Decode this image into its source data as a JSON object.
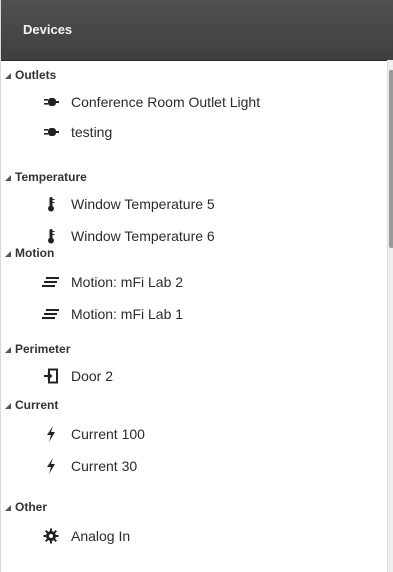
{
  "header": {
    "title": "Devices"
  },
  "groups": [
    {
      "label": "Outlets",
      "items": [
        {
          "label": "Conference Room Outlet Light",
          "icon": "plug-icon"
        },
        {
          "label": "testing",
          "icon": "plug-icon"
        }
      ]
    },
    {
      "label": "Temperature",
      "items": [
        {
          "label": "Window Temperature 5",
          "icon": "thermometer-icon"
        },
        {
          "label": "Window Temperature 6",
          "icon": "thermometer-icon"
        }
      ]
    },
    {
      "label": "Motion",
      "items": [
        {
          "label": "Motion: mFi Lab 2",
          "icon": "motion-icon"
        },
        {
          "label": "Motion: mFi Lab 1",
          "icon": "motion-icon"
        }
      ]
    },
    {
      "label": "Perimeter",
      "items": [
        {
          "label": "Door 2",
          "icon": "door-icon"
        }
      ]
    },
    {
      "label": "Current",
      "items": [
        {
          "label": "Current 100",
          "icon": "lightning-icon"
        },
        {
          "label": "Current 30",
          "icon": "lightning-icon"
        }
      ]
    },
    {
      "label": "Other",
      "items": [
        {
          "label": "Analog In",
          "icon": "gear-icon"
        }
      ]
    }
  ]
}
